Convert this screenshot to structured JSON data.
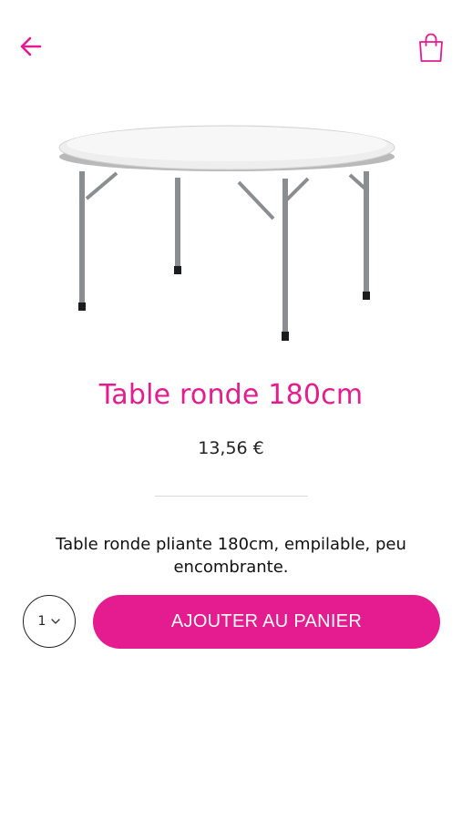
{
  "header": {
    "back_icon": "arrow-left-icon",
    "cart_icon": "shopping-bag-icon",
    "accent_color": "#e41c8f"
  },
  "product": {
    "image_icon": "round-folding-table",
    "title": "Table ronde 180cm",
    "price": "13,56 €",
    "description": "Table ronde pliante 180cm, empilable, peu encombrante."
  },
  "purchase": {
    "quantity": "1",
    "add_to_cart_label": "AJOUTER AU PANIER"
  }
}
